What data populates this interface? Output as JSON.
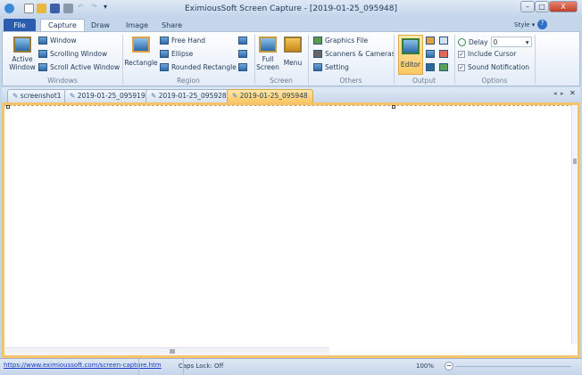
{
  "window": {
    "title": "EximiousSoft Screen Capture - [2019-01-25_095948]",
    "minimize": "–",
    "maximize": "□",
    "close": "X"
  },
  "ribbon_tabs": {
    "file": "File",
    "capture": "Capture",
    "draw": "Draw",
    "image": "Image",
    "share": "Share",
    "style": "Style ▾"
  },
  "windows_group": {
    "label": "Windows",
    "active_window": "Active Window",
    "window": "Window",
    "scrolling_window": "Scrolling Window",
    "scroll_active_window": "Scroll Active Window"
  },
  "region_group": {
    "label": "Region",
    "rectangle": "Rectangle",
    "free_hand": "Free Hand",
    "ellipse": "Ellipse",
    "rounded_rectangle": "Rounded Rectangle"
  },
  "screen_group": {
    "label": "Screen",
    "full_screen": "Full Screen",
    "menu": "Menu"
  },
  "others_group": {
    "label": "Others",
    "graphics_file": "Graphics File",
    "scanners": "Scanners & Cameras",
    "setting": "Setting"
  },
  "output_group": {
    "label": "Output",
    "editor": "Editor"
  },
  "options_group": {
    "label": "Options",
    "delay_label": "Delay",
    "delay_value": "0",
    "include_cursor": "Include Cursor",
    "sound_notification": "Sound Notification",
    "include_cursor_checked": true,
    "sound_checked": true
  },
  "doc_tabs": [
    "screenshot1",
    "2019-01-25_095919",
    "2019-01-25_095928",
    "2019-01-25_095948"
  ],
  "status": {
    "link": "https://www.eximioussoft.com/screen-capture.htm",
    "caps": "Caps Lock: Off",
    "zoom": "100%"
  }
}
